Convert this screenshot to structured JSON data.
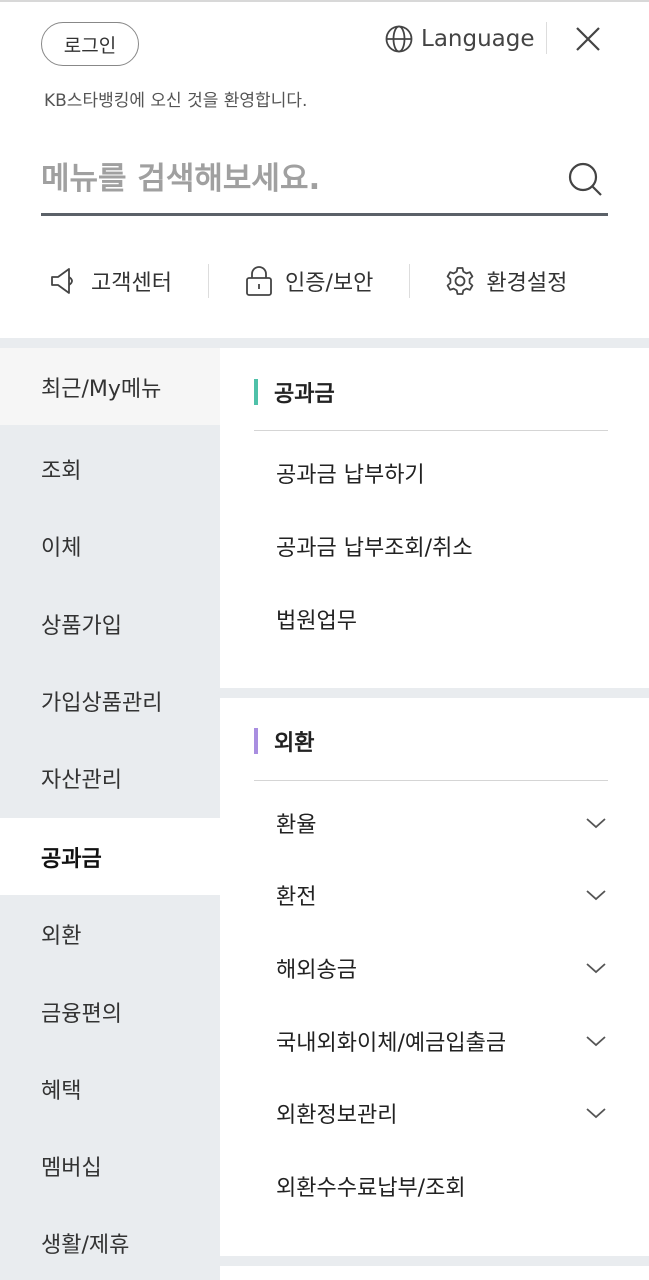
{
  "header": {
    "login_label": "로그인",
    "language_label": "Language",
    "welcome": "KB스타뱅킹에 오신 것을 환영합니다."
  },
  "search": {
    "placeholder": "메뉴를 검색해보세요."
  },
  "quick_links": [
    {
      "label": "고객센터",
      "icon": "megaphone-icon"
    },
    {
      "label": "인증/보안",
      "icon": "lock-icon"
    },
    {
      "label": "환경설정",
      "icon": "gear-icon"
    }
  ],
  "sidebar": {
    "items": [
      {
        "label": "최근/My메뉴"
      },
      {
        "label": "조회"
      },
      {
        "label": "이체"
      },
      {
        "label": "상품가입"
      },
      {
        "label": "가입상품관리"
      },
      {
        "label": "자산관리"
      },
      {
        "label": "공과금"
      },
      {
        "label": "외환"
      },
      {
        "label": "금융편의"
      },
      {
        "label": "혜택"
      },
      {
        "label": "멤버십"
      },
      {
        "label": "생활/제휴"
      }
    ],
    "active": "공과금"
  },
  "sections": [
    {
      "title": "공과금",
      "accent": "#4fc1a9",
      "items": [
        {
          "label": "공과금 납부하기"
        },
        {
          "label": "공과금 납부조회/취소"
        },
        {
          "label": "법원업무"
        }
      ]
    },
    {
      "title": "외환",
      "accent": "#a98ee0",
      "items": [
        {
          "label": "환율",
          "expandable": true
        },
        {
          "label": "환전",
          "expandable": true
        },
        {
          "label": "해외송금",
          "expandable": true
        },
        {
          "label": "국내외화이체/예금입출금",
          "expandable": true
        },
        {
          "label": "외환정보관리",
          "expandable": true
        },
        {
          "label": "외환수수료납부/조회"
        }
      ]
    }
  ]
}
